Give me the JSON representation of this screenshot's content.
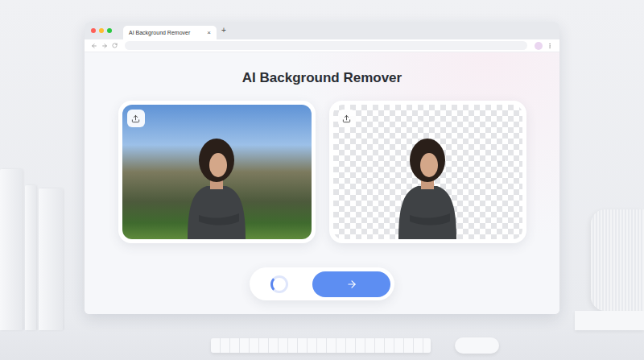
{
  "browser": {
    "tabs": [
      {
        "label": "AI Background Remover",
        "selected": true,
        "close": "×"
      }
    ],
    "new_tab": "+"
  },
  "page": {
    "title": "AI Background Remover",
    "panels": [
      {
        "kind": "original"
      },
      {
        "kind": "cutout"
      }
    ],
    "processing": true
  }
}
